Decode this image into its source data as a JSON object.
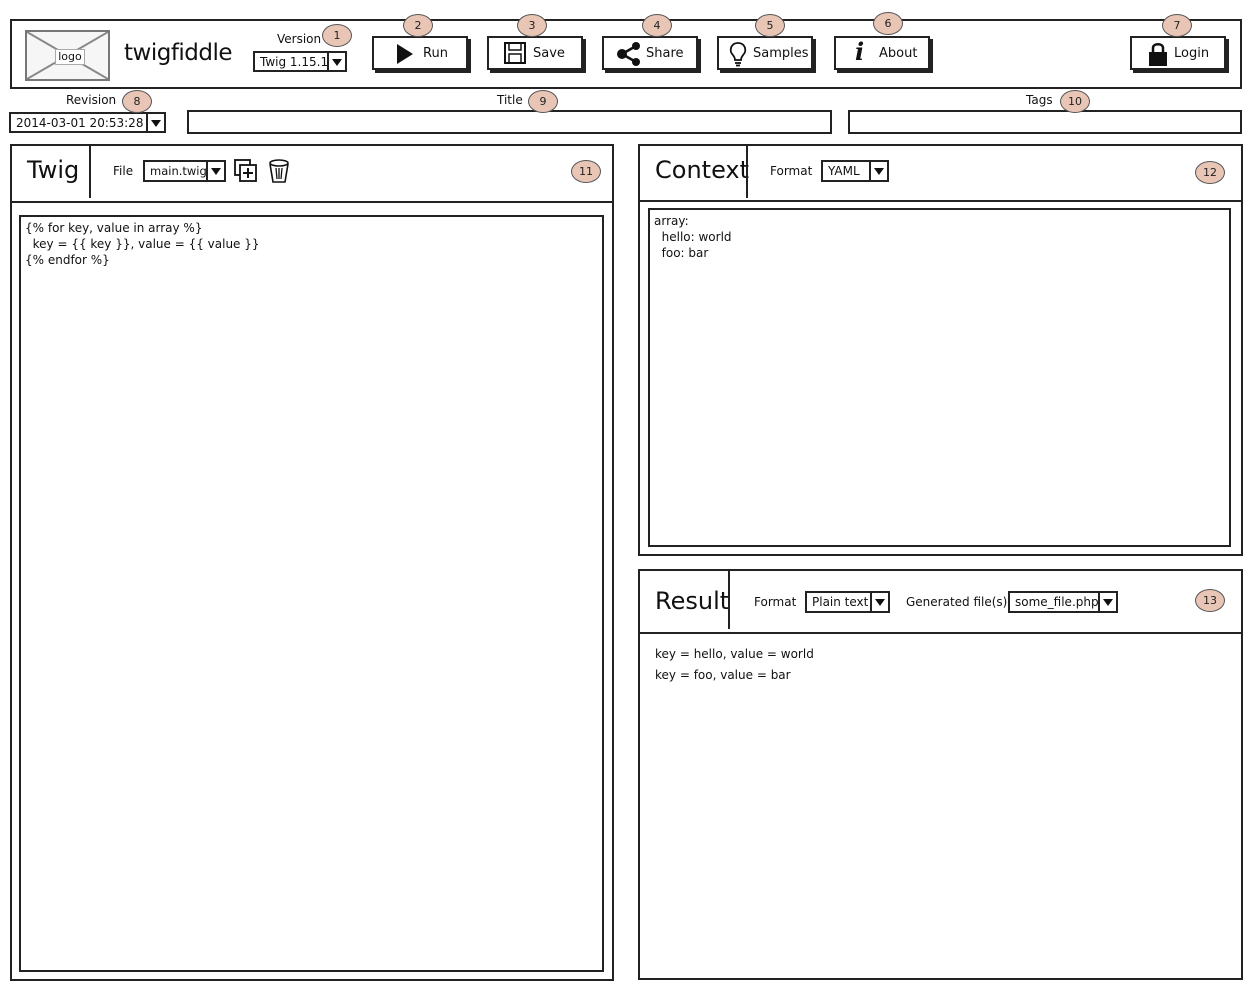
{
  "header": {
    "logo_text": "logo",
    "app_title": "twigfiddle",
    "version_label": "Version",
    "version_value": "Twig 1.15.1",
    "buttons": {
      "run": "Run",
      "save": "Save",
      "share": "Share",
      "samples": "Samples",
      "about": "About",
      "login": "Login"
    }
  },
  "meta_bar": {
    "revision_label": "Revision",
    "revision_value": "2014-03-01 20:53:28",
    "title_label": "Title",
    "title_value": "",
    "tags_label": "Tags",
    "tags_value": ""
  },
  "twig_panel": {
    "title": "Twig",
    "file_label": "File",
    "file_value": "main.twig",
    "code": "{% for key, value in array %}\n  key = {{ key }}, value = {{ value }}\n{% endfor %}"
  },
  "context_panel": {
    "title": "Context",
    "format_label": "Format",
    "format_value": "YAML",
    "code": "array:\n  hello: world\n  foo: bar"
  },
  "result_panel": {
    "title": "Result",
    "format_label": "Format",
    "format_value": "Plain text",
    "generated_label": "Generated file(s)",
    "generated_value": "some_file.php",
    "lines": [
      "key = hello, value = world",
      "key = foo, value = bar"
    ]
  },
  "badges": [
    "1",
    "2",
    "3",
    "4",
    "5",
    "6",
    "7",
    "8",
    "9",
    "10",
    "11",
    "12",
    "13"
  ],
  "colors": {
    "badge_fill": "#e9c5b6",
    "stroke": "#222222"
  },
  "icons": {
    "run": "play-icon",
    "save": "floppy-icon",
    "share": "share-icon",
    "samples": "lightbulb-icon",
    "about": "info-icon",
    "login": "lock-icon",
    "add_file": "add-file-icon",
    "delete_file": "trash-icon"
  }
}
